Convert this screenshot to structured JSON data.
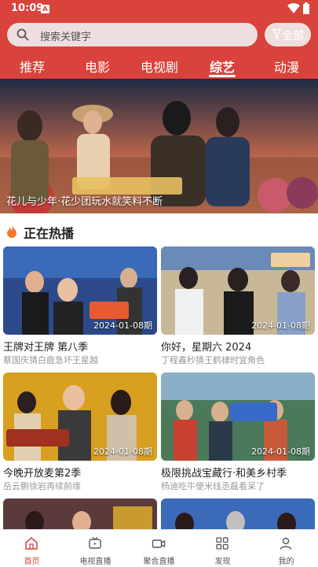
{
  "status": {
    "time": "10:09"
  },
  "search": {
    "placeholder": "搜索关键字"
  },
  "filter": {
    "label": "全部"
  },
  "tabs": [
    "推荐",
    "电影",
    "电视剧",
    "综艺",
    "动漫"
  ],
  "active_tab": "综艺",
  "banner": {
    "caption": "花儿与少年·花少团玩水就笑料不断"
  },
  "section": {
    "title": "正在热播"
  },
  "cards": [
    {
      "title": "王牌对王牌 第八季",
      "subtitle": "蔡国庆猜白鹿急坏王星越",
      "date": "2024-01-08期"
    },
    {
      "title": "你好，星期六 2024",
      "subtitle": "丁程鑫秒猜王鹤棣时宜角色",
      "date": "2024-01-08期"
    },
    {
      "title": "今晚开放麦第2季",
      "subtitle": "岳云鹏徐岩再续前缘",
      "date": "2024-01-08期"
    },
    {
      "title": "极限挑战宝藏行·和美乡村季",
      "subtitle": "杨迪吃牛便米线丞磊看呆了",
      "date": "2024-01-08期"
    }
  ],
  "bottom_nav": [
    {
      "label": "首页",
      "icon": "home-icon"
    },
    {
      "label": "电视直播",
      "icon": "tv-icon"
    },
    {
      "label": "聚合直播",
      "icon": "video-camera-icon"
    },
    {
      "label": "发现",
      "icon": "grid-icon"
    },
    {
      "label": "我的",
      "icon": "user-icon"
    }
  ],
  "colors": {
    "brand": "#d9433b",
    "active_nav": "#d9433b"
  }
}
